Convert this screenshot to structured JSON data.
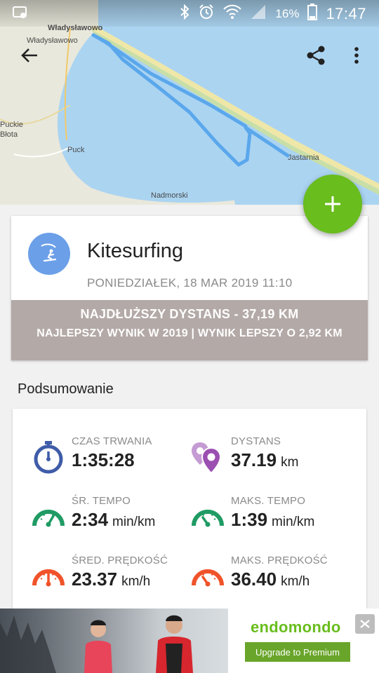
{
  "status_bar": {
    "battery": "16%",
    "time": "17:47"
  },
  "map": {
    "labels": [
      "Władysławowo",
      "Władysławowo",
      "Puckie",
      "Błota",
      "Puck",
      "Jastarnia",
      "Nadmorski"
    ]
  },
  "activity": {
    "sport": "Kitesurfing",
    "date": "PONIEDZIAŁEK, 18 MAR 2019 11:10",
    "record_title": "NAJDŁUŻSZY DYSTANS  -  37,19 KM",
    "record_sub": "NAJLEPSZY WYNIK W 2019  |  WYNIK LEPSZY O 2,92 KM"
  },
  "summary": {
    "title": "Podsumowanie",
    "stats": [
      {
        "label": "CZAS TRWANIA",
        "value": "1:35:28",
        "unit": "",
        "icon": "stopwatch-icon",
        "color": "#3f5ca8"
      },
      {
        "label": "DYSTANS",
        "value": "37.19",
        "unit": "km",
        "icon": "location-pins-icon",
        "color": "#9b4fb1"
      },
      {
        "label": "ŚR. TEMPO",
        "value": "2:34",
        "unit": "min/km",
        "icon": "speedometer-icon",
        "color": "#1f9b64"
      },
      {
        "label": "MAKS. TEMPO",
        "value": "1:39",
        "unit": "min/km",
        "icon": "speedometer-icon",
        "color": "#1f9b64"
      },
      {
        "label": "ŚRED. PRĘDKOŚĆ",
        "value": "23.37",
        "unit": "km/h",
        "icon": "speedometer-icon",
        "color": "#f0532a"
      },
      {
        "label": "MAKS. PRĘDKOŚĆ",
        "value": "36.40",
        "unit": "km/h",
        "icon": "speedometer-icon",
        "color": "#f0532a"
      }
    ]
  },
  "ad": {
    "brand": "endomondo",
    "button": "Upgrade to Premium"
  },
  "colors": {
    "accent_green": "#69bd1d",
    "route_blue": "#5aa7ec",
    "record_band": "#b3a9a7"
  }
}
